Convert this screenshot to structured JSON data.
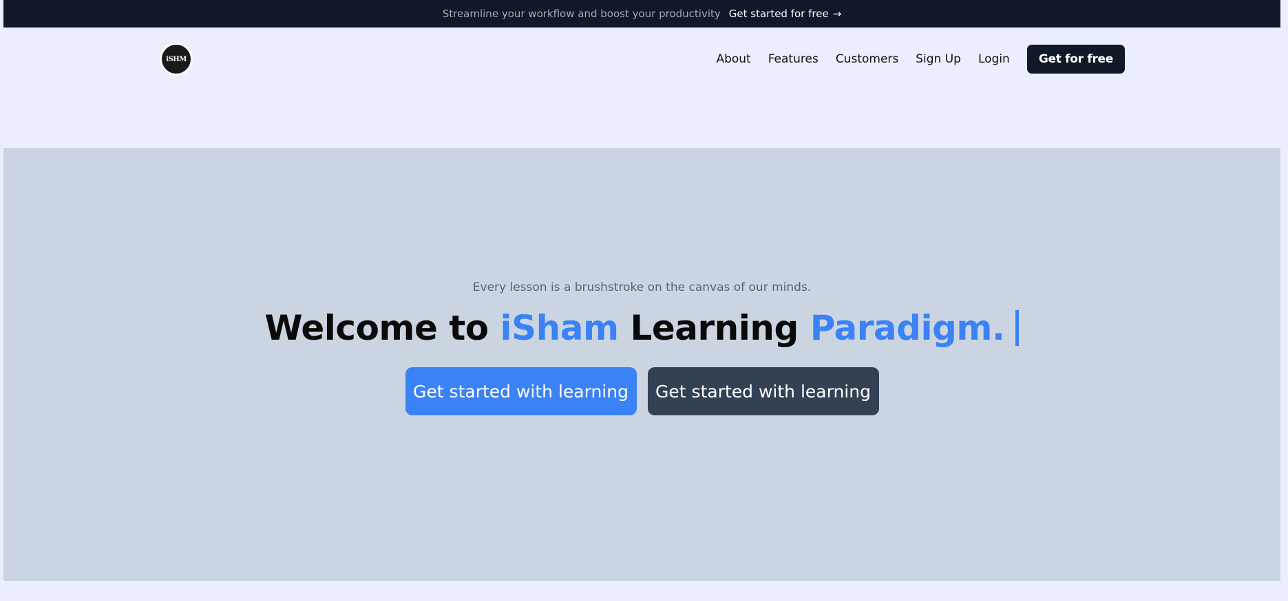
{
  "announcement": {
    "message": "Streamline your workflow and boost your productivity",
    "cta_label": "Get started for free",
    "cta_icon": "→"
  },
  "nav": {
    "logo_text": "iSHM",
    "links": [
      "About",
      "Features",
      "Customers",
      "Sign Up",
      "Login"
    ],
    "cta_label": "Get for free"
  },
  "hero": {
    "tagline": "Every lesson is a brushstroke on the canvas of our minds.",
    "headline": {
      "part1": "Welcome to ",
      "accent1": "iSham",
      "part2": " Learning ",
      "accent2": "Paradigm."
    },
    "primary_button": "Get started with learning",
    "secondary_button": "Get started with learning"
  },
  "colors": {
    "accent": "#3b82f6",
    "dark": "#111827",
    "hero_bg": "#cbd5e1",
    "page_bg": "#eaeeff",
    "secondary_button": "#334155"
  }
}
